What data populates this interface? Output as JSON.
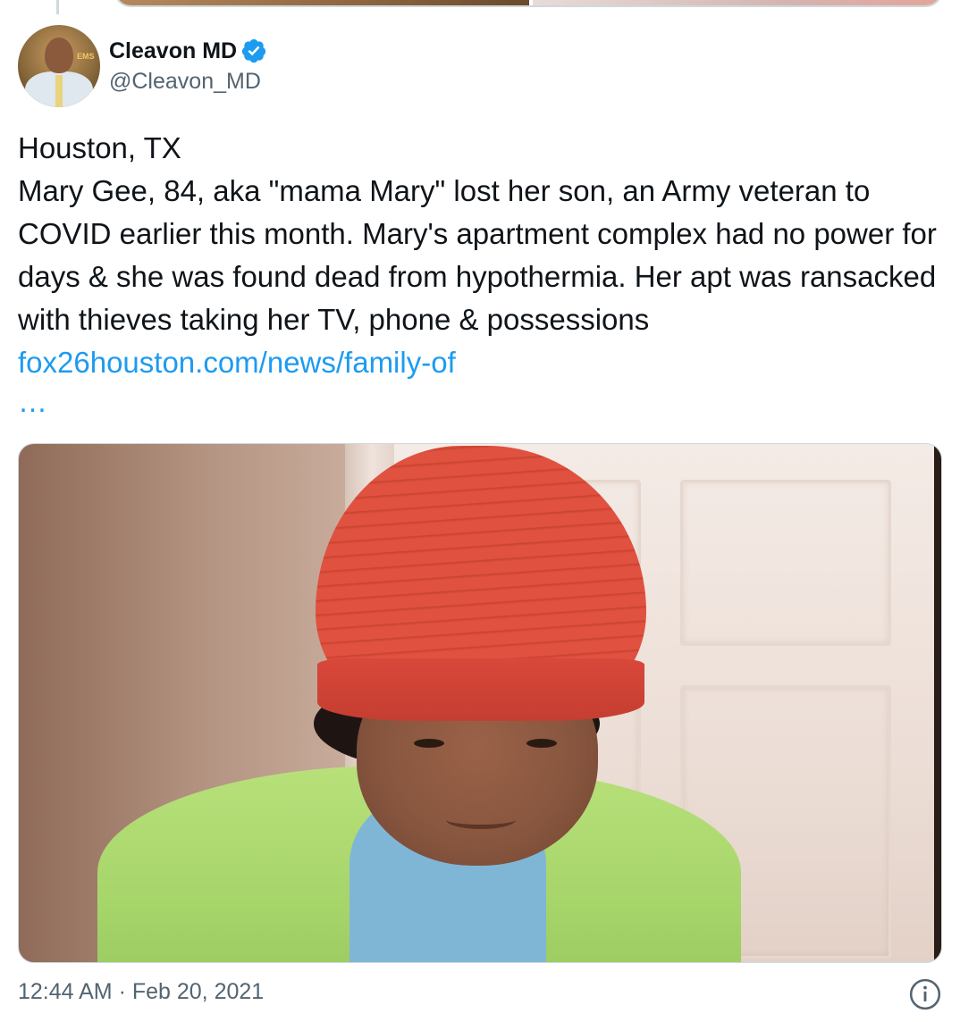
{
  "author": {
    "display_name": "Cleavon MD",
    "handle": "@Cleavon_MD",
    "verified": true,
    "avatar_icon": "avatar-photo",
    "avatar_sign_text": "EMS"
  },
  "tweet": {
    "text_lines": "Houston, TX\nMary Gee, 84, aka \"mama Mary\" lost her son, an Army veteran to COVID earlier this month. Mary's apartment complex had no power for days & she was found dead from hypothermia. Her apt was ransacked with thieves taking her TV, phone & possessions ",
    "link_text": "fox26houston.com/news/family-of",
    "ellipsis": "…",
    "media_icon": "photo-of-woman-in-red-hat",
    "timestamp": "12:44 AM · Feb 20, 2021"
  },
  "colors": {
    "text": "#0f1419",
    "secondary": "#536471",
    "link": "#1d9bf0",
    "border": "#cfd9de",
    "verified_badge": "#1d9bf0"
  },
  "icons": {
    "verified": "verified-badge-icon",
    "info": "info-icon"
  }
}
